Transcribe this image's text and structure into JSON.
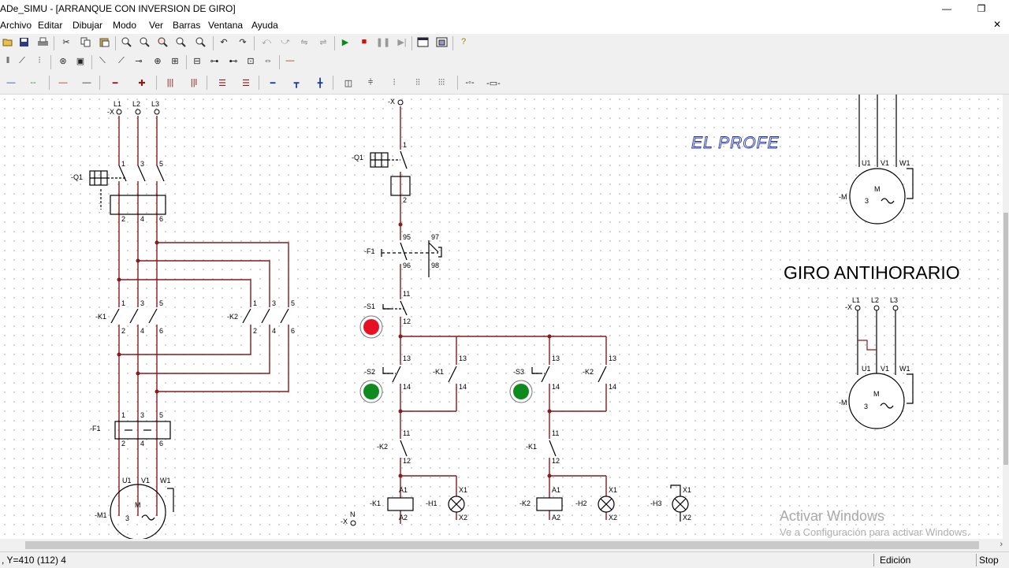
{
  "window": {
    "title": "ADe_SIMU - [ARRANQUE CON INVERSION DE GIRO]",
    "minimize": "—",
    "restore": "❐",
    "close": "✕"
  },
  "menu": [
    "Archivo",
    "Editar",
    "Dibujar",
    "Modo",
    "Ver",
    "Barras",
    "Ventana",
    "Ayuda"
  ],
  "diagram": {
    "brand": "EL PROFE",
    "heading": "GIRO ANTIHORARIO",
    "power": {
      "phases": [
        "L1",
        "L2",
        "L3"
      ],
      "x_tag": "-X",
      "q1": "-Q1",
      "k1": "-K1",
      "k2": "-K2",
      "f1": "-F1",
      "m1": "-M1",
      "motor_terms": [
        "U1",
        "V1",
        "W1"
      ],
      "motor_m": "M",
      "motor_3": "3",
      "odd_terms": [
        "1",
        "3",
        "5"
      ],
      "even_terms": [
        "2",
        "4",
        "6"
      ]
    },
    "control": {
      "x_top": "-X",
      "q1": "-Q1",
      "f1": "-F1",
      "s1": "-S1",
      "s2": "-S2",
      "s3": "-S3",
      "k1": "-K1",
      "k2": "-K2",
      "h1": "-H1",
      "h2": "-H2",
      "h3": "-H3",
      "x_bottom": "-X",
      "n": "N",
      "t1": "1",
      "t2": "2",
      "t95": "95",
      "t96": "96",
      "t97": "97",
      "t98": "98",
      "t11": "11",
      "t12": "12",
      "t13": "13",
      "t14": "14",
      "a1": "A1",
      "a2": "A2",
      "x1": "X1",
      "x2": "X2"
    },
    "motor_top": {
      "m_tag": "-M",
      "terms": [
        "U1",
        "V1",
        "W1"
      ],
      "m": "M",
      "three": "3"
    },
    "motor_right": {
      "x_tag": "-X",
      "phases": [
        "L1",
        "L2",
        "L3"
      ],
      "m_tag": "-M",
      "terms": [
        "U1",
        "V1",
        "W1"
      ],
      "m": "M",
      "three": "3"
    }
  },
  "watermark": {
    "line1": "Activar Windows",
    "line2": "Ve a Configuración para activar Windows."
  },
  "status": {
    "coords": ", Y=410 (112) 4",
    "mode": "Edición",
    "run": "Stop"
  },
  "colors": {
    "wire_red": "#8b1a1a",
    "lamp_red": "#e81123",
    "lamp_green": "#0f8a1e",
    "brand_blue": "#1a2bb0"
  }
}
